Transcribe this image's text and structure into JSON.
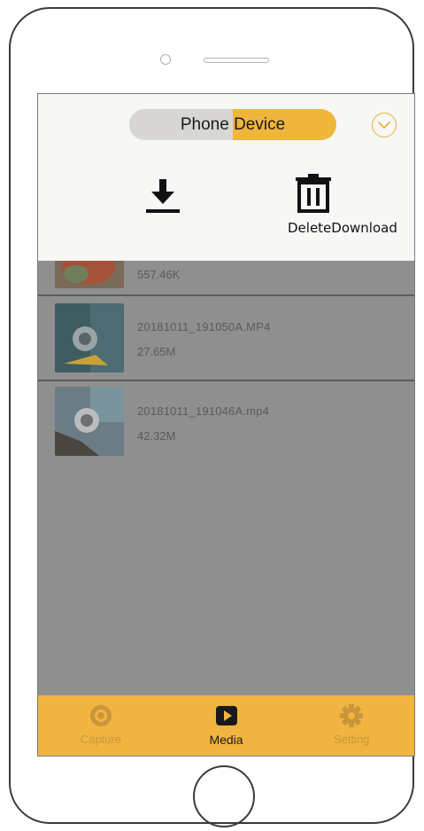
{
  "header": {
    "segment_label": "Phone Device",
    "action_label": "DeleteDownload"
  },
  "media": {
    "items": [
      {
        "name": "",
        "size": "557.46K"
      },
      {
        "name": "20181011_191050A.MP4",
        "size": "27.65M"
      },
      {
        "name": "20181011_191046A.mp4",
        "size": "42.32M"
      }
    ]
  },
  "tabs": [
    {
      "label": "Capture",
      "icon": "camera-icon",
      "active": false
    },
    {
      "label": "Media",
      "icon": "play-icon",
      "active": true
    },
    {
      "label": "Setting",
      "icon": "gear-icon",
      "active": false
    }
  ],
  "colors": {
    "accent": "#f0b63c",
    "overlay": "#8f8f8f",
    "header_bg": "#f7f7f5"
  }
}
